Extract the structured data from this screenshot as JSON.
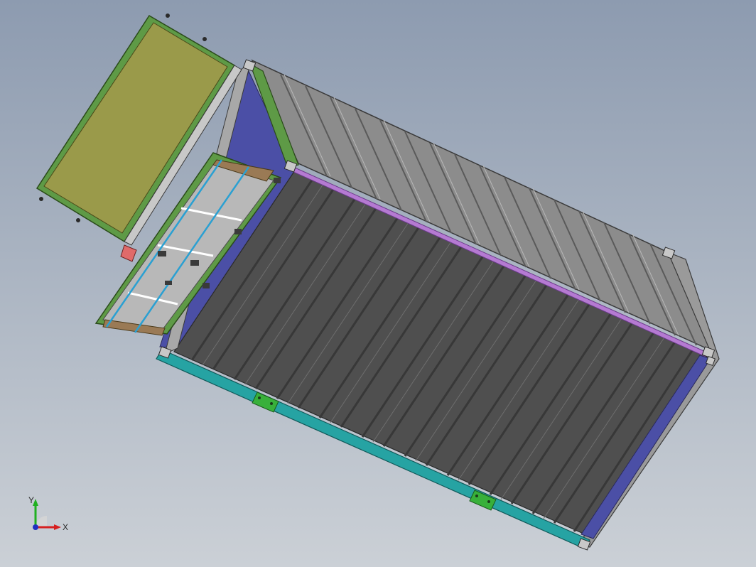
{
  "viewport": {
    "background_top": "#8d9bb0",
    "background_bottom": "#cbd0d6"
  },
  "model": {
    "components": [
      "open-door",
      "door-hinge-frame",
      "corrugated-side-wall",
      "floor-panels",
      "left-long-rail",
      "right-purple-rail",
      "forklift-pocket",
      "end-frame",
      "corner-castings",
      "folding-rack"
    ],
    "colors": {
      "door_panel": "#9a9a4a",
      "door_frame": "#5e9a46",
      "side_wall": "#8a8a8a",
      "floor": "#4f4f4f",
      "rail_left": "#26a3a3",
      "rail_purple": "#b57ad2",
      "inner_blue": "#4b4fa6",
      "forklift_pocket": "#38b03a",
      "rack_frame": "#5e9a46",
      "rack_panel": "#b8b8b8",
      "rack_wood": "#9a7a55",
      "rack_cable": "#2aa0d2"
    }
  },
  "triad": {
    "x_label": "X",
    "y_label": "Y",
    "x_color": "#d62020",
    "y_color": "#20b020",
    "z_color": "#2030c0"
  }
}
